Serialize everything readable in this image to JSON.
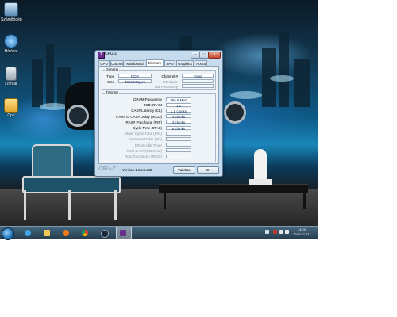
{
  "desktop_icons": [
    {
      "label": "Számítógép"
    },
    {
      "label": "Hálózat"
    },
    {
      "label": "Lomtár"
    },
    {
      "label": "Cpu"
    }
  ],
  "window": {
    "title": "CPU-Z",
    "tabs": [
      "CPU",
      "Caches",
      "Mainboard",
      "Memory",
      "SPD",
      "Graphics",
      "About"
    ],
    "active_tab": "Memory",
    "general": {
      "title": "General",
      "type_label": "Type",
      "type_value": "DDR",
      "size_label": "Size",
      "size_value": "4096 MBytes",
      "channel_label": "Channel #",
      "channel_value": "Dual",
      "dc_mode_label": "DC Mode",
      "nb_freq_label": "NB Frequency"
    },
    "timings": {
      "title": "Timings",
      "rows": [
        {
          "label": "DRAM Frequency",
          "value": "166.5 MHz",
          "dim": false
        },
        {
          "label": "FSB:DRAM",
          "value": "1:1",
          "dim": false
        },
        {
          "label": "CAS# Latency (CL)",
          "value": "2.5 clocks",
          "dim": false
        },
        {
          "label": "RAS# to CAS# Delay (tRCD)",
          "value": "4 clocks",
          "dim": false
        },
        {
          "label": "RAS# Precharge (tRP)",
          "value": "4 clocks",
          "dim": false
        },
        {
          "label": "Cycle Time (tRAS)",
          "value": "8 clocks",
          "dim": false
        },
        {
          "label": "Bank Cycle Time (tRC)",
          "value": "",
          "dim": true
        },
        {
          "label": "Command Rate (CR)",
          "value": "",
          "dim": true
        },
        {
          "label": "DRAM Idle Timer",
          "value": "",
          "dim": true
        },
        {
          "label": "Total CAS# (tRDRAM)",
          "value": "",
          "dim": true
        },
        {
          "label": "Row To Column (tRCD)",
          "value": "",
          "dim": true
        }
      ]
    },
    "footer": {
      "brand": "CPU-Z",
      "version": "Version 1.64.0.x32",
      "validate_label": "Validate",
      "ok_label": "OK"
    }
  },
  "taskbar": {
    "clock_time": "14:20",
    "clock_date": "2013.02.27."
  },
  "colors": {
    "window_frame": "#c6dcee",
    "taskbar": "#243b4c",
    "value_text": "#0a2a5a"
  }
}
